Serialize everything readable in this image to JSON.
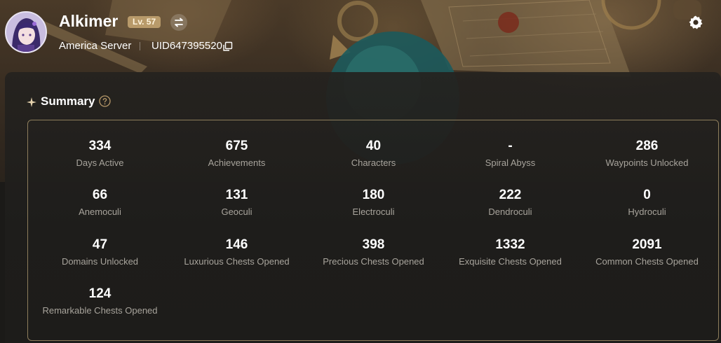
{
  "profile": {
    "nickname": "Alkimer",
    "level": "Lv. 57",
    "server": "America Server",
    "uid": "UID647395520"
  },
  "icons": {
    "switch": "switch-account-icon",
    "copy": "copy-icon",
    "settings": "gear-icon",
    "help": "help-icon",
    "section": "sparkle-icon"
  },
  "colors": {
    "accent": "#b89a6a",
    "border": "#8d7d5c",
    "label": "#a8a49c"
  },
  "summary": {
    "title": "Summary",
    "stats": [
      {
        "value": "334",
        "label": "Days Active"
      },
      {
        "value": "675",
        "label": "Achievements"
      },
      {
        "value": "40",
        "label": "Characters"
      },
      {
        "value": "-",
        "label": "Spiral Abyss"
      },
      {
        "value": "286",
        "label": "Waypoints Unlocked"
      },
      {
        "value": "66",
        "label": "Anemoculi"
      },
      {
        "value": "131",
        "label": "Geoculi"
      },
      {
        "value": "180",
        "label": "Electroculi"
      },
      {
        "value": "222",
        "label": "Dendroculi"
      },
      {
        "value": "0",
        "label": "Hydroculi"
      },
      {
        "value": "47",
        "label": "Domains Unlocked"
      },
      {
        "value": "146",
        "label": "Luxurious Chests Opened"
      },
      {
        "value": "398",
        "label": "Precious Chests Opened"
      },
      {
        "value": "1332",
        "label": "Exquisite Chests Opened"
      },
      {
        "value": "2091",
        "label": "Common Chests Opened"
      },
      {
        "value": "124",
        "label": "Remarkable Chests Opened"
      }
    ]
  }
}
